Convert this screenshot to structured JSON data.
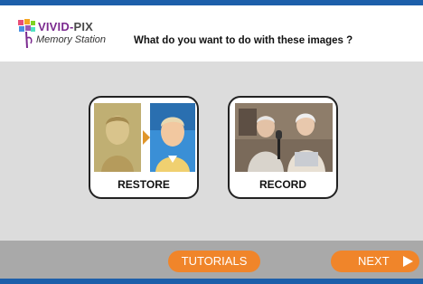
{
  "header": {
    "logo_brand_primary": "VIVID-",
    "logo_brand_secondary": "PIX",
    "logo_subtitle": "Memory Station",
    "question": "What do you want to do with these images ?"
  },
  "options": {
    "restore_label": "RESTORE",
    "record_label": "RECORD"
  },
  "footer": {
    "tutorials_label": "TUTORIALS",
    "next_label": "NEXT"
  },
  "colors": {
    "frame_blue": "#1d5faa",
    "button_orange": "#f0852a",
    "panel_gray": "#dcdcdc",
    "footer_gray": "#a9a9a9",
    "brand_purple": "#7b2a8f"
  },
  "icons": [
    "vivid-pix-logo-icon",
    "sepia-photo-icon",
    "restored-photo-icon",
    "arrow-right-icon",
    "seniors-recording-photo-icon",
    "play-triangle-icon"
  ]
}
